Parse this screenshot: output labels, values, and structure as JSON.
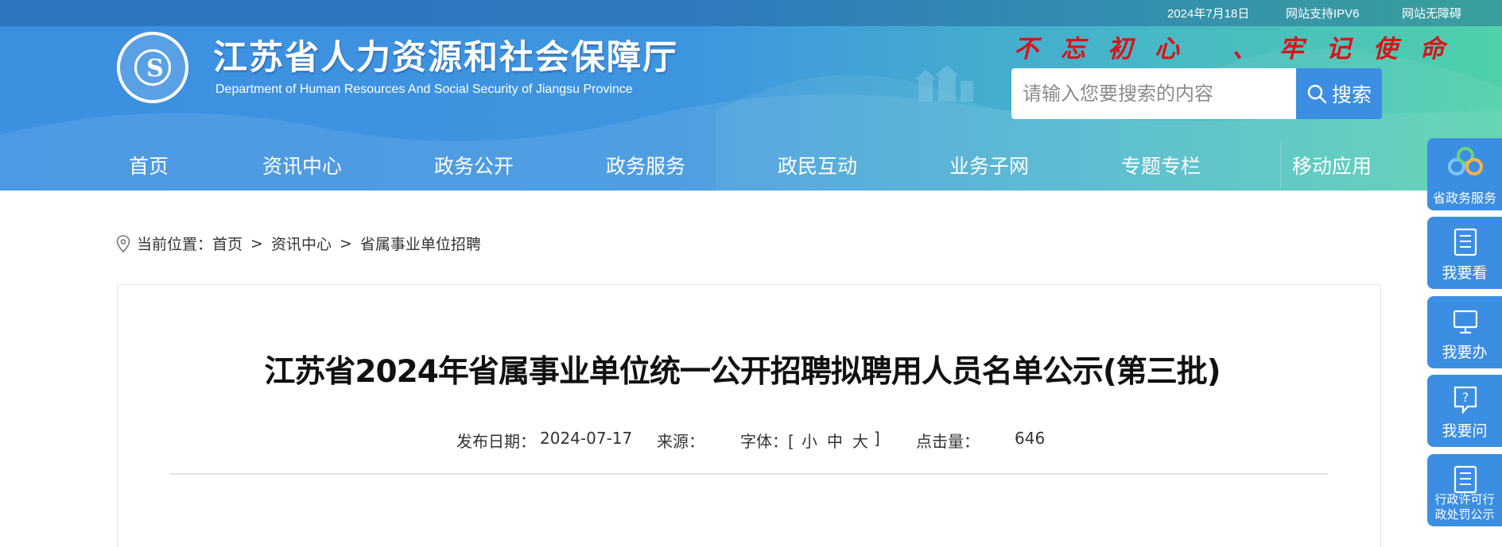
{
  "topbar": {
    "date": "2024年7月18日",
    "ipv6": "网站支持IPV6",
    "accessibility": "网站无障碍"
  },
  "header": {
    "title": "江苏省人力资源和社会保障厅",
    "subtitle": "Department of Human Resources And Social Security of Jiangsu Province",
    "slogan": "不忘初心 、牢记使命"
  },
  "search": {
    "placeholder": "请输入您要搜索的内容",
    "button_label": "搜索"
  },
  "nav": {
    "items": [
      "首页",
      "资讯中心",
      "政务公开",
      "政务服务",
      "政民互动",
      "业务子网",
      "专题专栏",
      "移动应用"
    ]
  },
  "breadcrumb": {
    "prefix": "当前位置：",
    "items": [
      "首页",
      "资讯中心",
      "省属事业单位招聘"
    ],
    "separator": ">"
  },
  "article": {
    "title": "江苏省2024年省属事业单位统一公开招聘拟聘用人员名单公示(第三批)",
    "date_label": "发布日期：",
    "date_value": "2024-07-17",
    "source_label": "来源：",
    "font_label": "字体：[",
    "font_small": "小",
    "font_medium": "中",
    "font_large": "大",
    "font_close": "]",
    "views_label": "点击量：",
    "views_value": "646"
  },
  "sidebar": {
    "items": [
      "省政务服务",
      "我要看",
      "我要办",
      "我要问",
      "行政许可行政处罚公示"
    ]
  },
  "colors": {
    "header_blue": "#3d8fe0",
    "header_green": "#4fd0aa",
    "slogan_red": "#d8141b",
    "button_blue": "#3b8ee1"
  }
}
